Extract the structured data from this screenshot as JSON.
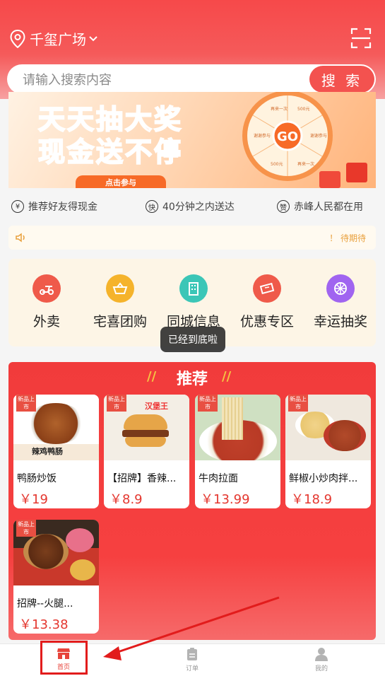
{
  "header": {
    "location": "千玺广场",
    "search_placeholder": "请输入搜索内容",
    "search_button": "搜 索"
  },
  "banner": {
    "line1": "天天抽大奖",
    "line2": "现金送不停",
    "cta": "点击参与",
    "wheel_center": "GO",
    "wheel_slices": [
      "再来一次",
      "500元",
      "谢谢参与",
      "再来一次",
      "500元",
      "谢谢参与"
    ]
  },
  "features": [
    {
      "icon": "¥",
      "text": "推荐好友得现金"
    },
    {
      "icon": "快",
      "text": "40分钟之内送达"
    },
    {
      "icon": "赞",
      "text": "赤峰人民都在用"
    }
  ],
  "notice": {
    "right_text": "！ 待期待"
  },
  "categories": [
    {
      "label": "外卖",
      "color": "#ef5a4a"
    },
    {
      "label": "宅喜团购",
      "color": "#f5b32b"
    },
    {
      "label": "同城信息",
      "color": "#3bc6b7"
    },
    {
      "label": "优惠专区",
      "color": "#ef5a4a"
    },
    {
      "label": "幸运抽奖",
      "color": "#a064f0"
    }
  ],
  "toast": "已经到底啦",
  "recommend": {
    "title": "推荐",
    "tag": "新品上市",
    "items": [
      {
        "name": "鸭肠炒饭",
        "price": "￥19",
        "img_text": "辣鸡鸭肠"
      },
      {
        "name": "【招牌】香辣...",
        "price": "￥8.9",
        "img_text": "汉堡王"
      },
      {
        "name": "牛肉拉面",
        "price": "￥13.99",
        "img_text": ""
      },
      {
        "name": "鲜椒小炒肉拌...",
        "price": "￥18.9",
        "img_text": ""
      },
      {
        "name": "招牌--火腿...",
        "price": "￥13.38",
        "img_text": ""
      }
    ]
  },
  "tabbar": [
    {
      "label": "首页",
      "active": true
    },
    {
      "label": "订单",
      "active": false
    },
    {
      "label": "我的",
      "active": false
    }
  ],
  "colors": {
    "primary": "#f3524f",
    "price": "#e4372f",
    "highlight": "#e21c1c"
  }
}
